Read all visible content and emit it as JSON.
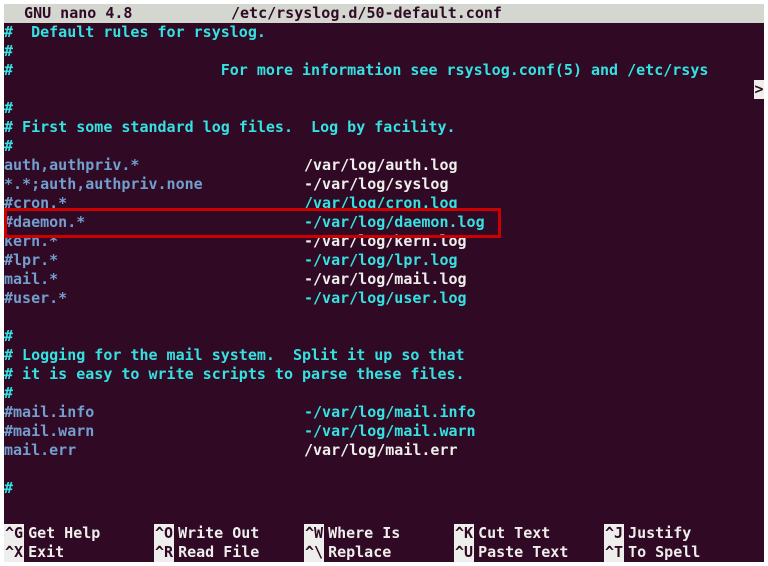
{
  "header": {
    "app": "  GNU nano 4.8",
    "file": "/etc/rsyslog.d/50-default.conf"
  },
  "lines": [
    {
      "style": "comment",
      "text": "#  Default rules for rsyslog."
    },
    {
      "style": "comment",
      "text": "#"
    },
    {
      "style": "comment",
      "text": "#                       For more information see rsyslog.conf(5) and /etc/rsys"
    },
    {
      "style": "blank",
      "text": ""
    },
    {
      "style": "comment",
      "text": "#"
    },
    {
      "style": "comment",
      "text": "# First some standard log files.  Log by facility."
    },
    {
      "style": "comment",
      "text": "#"
    },
    {
      "style": "normal",
      "selector": "auth,authpriv.*",
      "path": "/var/log/auth.log"
    },
    {
      "style": "normal",
      "selector": "*.*;auth,authpriv.none",
      "path": "-/var/log/syslog"
    },
    {
      "style": "comment",
      "selector": "#cron.*",
      "path": "/var/log/cron.log"
    },
    {
      "style": "comment",
      "selector": "#daemon.*",
      "path": "-/var/log/daemon.log"
    },
    {
      "style": "normal",
      "selector": "kern.*",
      "path": "-/var/log/kern.log"
    },
    {
      "style": "comment",
      "selector": "#lpr.*",
      "path": "-/var/log/lpr.log"
    },
    {
      "style": "normal",
      "selector": "mail.*",
      "path": "-/var/log/mail.log"
    },
    {
      "style": "comment",
      "selector": "#user.*",
      "path": "-/var/log/user.log"
    },
    {
      "style": "blank",
      "text": ""
    },
    {
      "style": "comment",
      "text": "#"
    },
    {
      "style": "comment",
      "text": "# Logging for the mail system.  Split it up so that"
    },
    {
      "style": "comment",
      "text": "# it is easy to write scripts to parse these files."
    },
    {
      "style": "comment",
      "text": "#"
    },
    {
      "style": "comment",
      "selector": "#mail.info",
      "path": "-/var/log/mail.info"
    },
    {
      "style": "comment",
      "selector": "#mail.warn",
      "path": "-/var/log/mail.warn"
    },
    {
      "style": "normal",
      "selector": "mail.err",
      "path": "/var/log/mail.err"
    },
    {
      "style": "blank",
      "text": ""
    },
    {
      "style": "comment",
      "text": "#"
    }
  ],
  "overflow": ">",
  "menu": {
    "row1": [
      {
        "key": "^G",
        "label": "Get Help"
      },
      {
        "key": "^O",
        "label": "Write Out"
      },
      {
        "key": "^W",
        "label": "Where Is"
      },
      {
        "key": "^K",
        "label": "Cut Text"
      },
      {
        "key": "^J",
        "label": "Justify"
      }
    ],
    "row2": [
      {
        "key": "^X",
        "label": "Exit"
      },
      {
        "key": "^R",
        "label": "Read File"
      },
      {
        "key": "^\\",
        "label": "Replace"
      },
      {
        "key": "^U",
        "label": "Paste Text"
      },
      {
        "key": "^T",
        "label": "To Spell"
      }
    ]
  }
}
